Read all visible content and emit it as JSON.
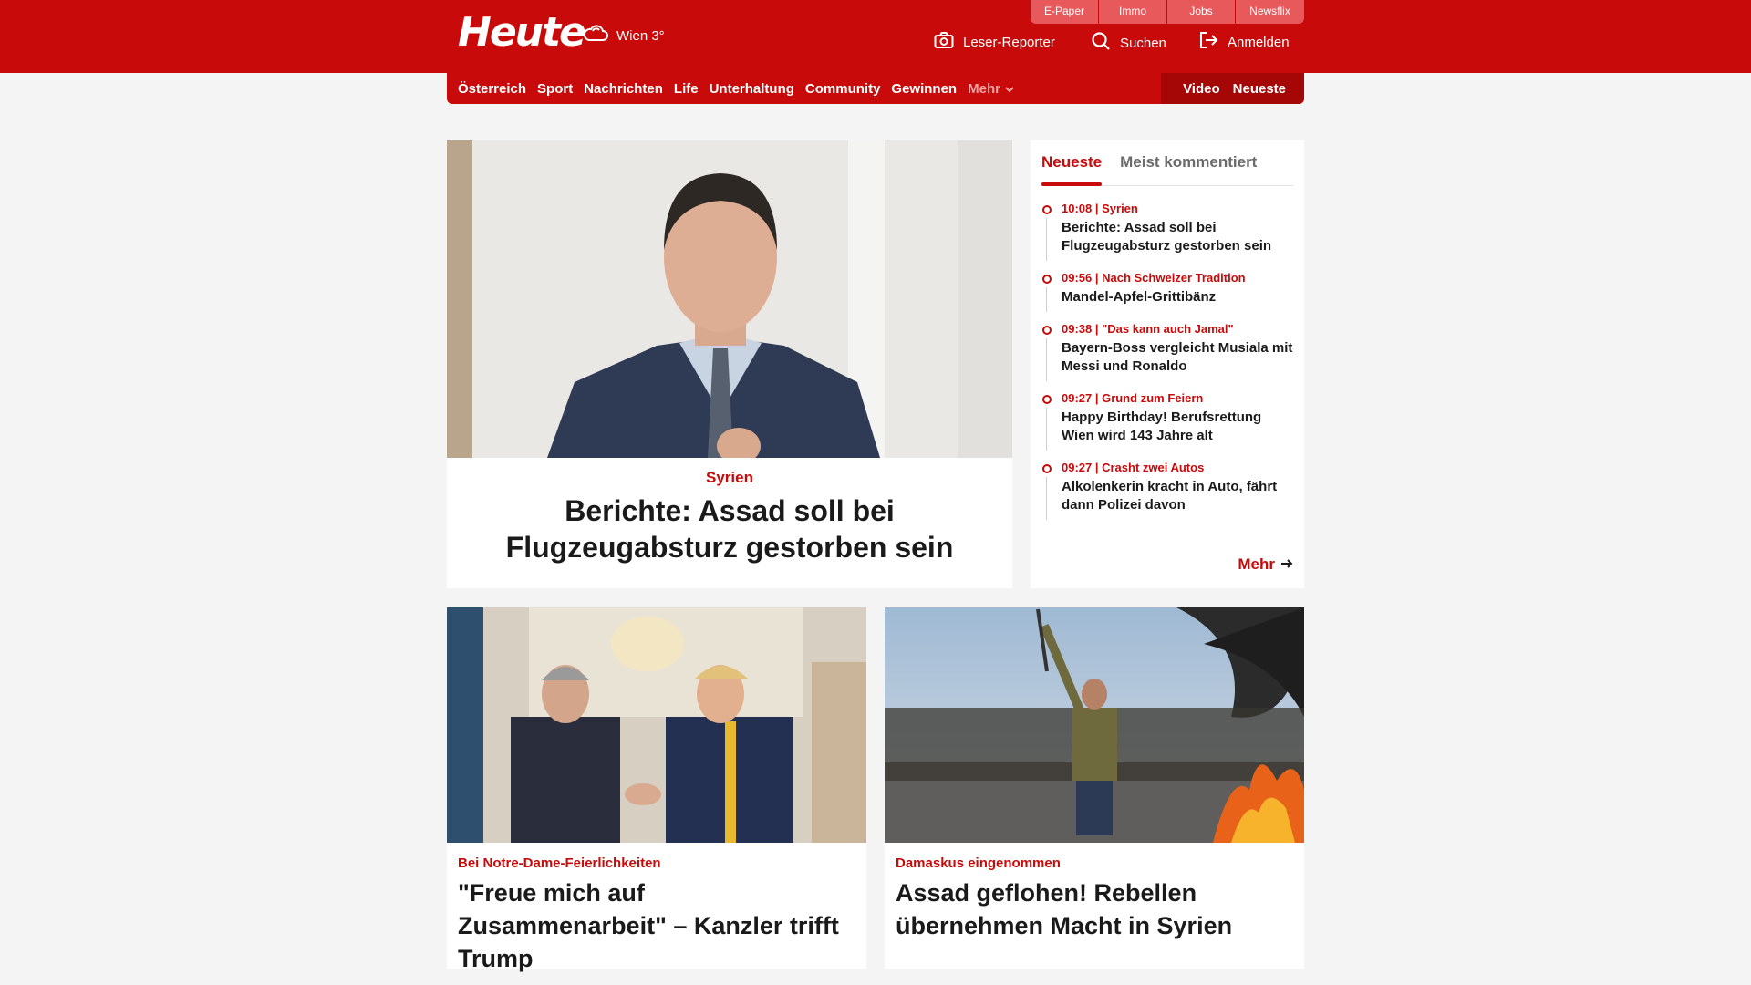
{
  "topbar": {
    "links": [
      "E-Paper",
      "Immo",
      "Jobs",
      "Newsflix"
    ]
  },
  "header": {
    "logo": "Heute",
    "weather": "Wien 3°",
    "actions": {
      "reporter": "Leser-Reporter",
      "search": "Suchen",
      "login": "Anmelden"
    }
  },
  "nav": {
    "items": [
      "Österreich",
      "Sport",
      "Nachrichten",
      "Life",
      "Unterhaltung",
      "Community",
      "Gewinnen"
    ],
    "more": "Mehr",
    "right": {
      "video": "Video",
      "newest": "Neueste"
    }
  },
  "hero": {
    "kicker": "Syrien",
    "title": "Berichte: Assad soll bei Flugzeugabsturz gestorben sein"
  },
  "sidebar": {
    "tabs": [
      "Neueste",
      "Meist kommentiert"
    ],
    "items": [
      {
        "meta": "10:08 | Syrien",
        "title": "Berichte: Assad soll bei Flugzeugabsturz gestorben sein"
      },
      {
        "meta": "09:56 | Nach Schweizer Tradition",
        "title": "Mandel-Apfel-Grittibänz"
      },
      {
        "meta": "09:38 | \"Das kann auch Jamal\"",
        "title": "Bayern-Boss vergleicht Musiala mit Messi und Ronaldo"
      },
      {
        "meta": "09:27 | Grund zum Feiern",
        "title": "Happy Birthday! Berufsrettung Wien wird 143 Jahre alt"
      },
      {
        "meta": "09:27 | Crasht zwei Autos",
        "title": "Alkolenkerin kracht in Auto, fährt dann Polizei davon"
      }
    ],
    "more": "Mehr"
  },
  "cards": [
    {
      "kicker": "Bei Notre-Dame-Feierlichkeiten",
      "title": "\"Freue mich auf Zusammenarbeit\" – Kanzler trifft Trump"
    },
    {
      "kicker": "Damaskus eingenommen",
      "title": "Assad geflohen! Rebellen übernehmen Macht in Syrien"
    }
  ],
  "colors": {
    "brand": "#c80a0a",
    "navDark": "#a50707",
    "topbarLink": "#e8595c"
  },
  "icons": [
    "weather-cloud-icon",
    "camera-icon",
    "search-icon",
    "login-icon",
    "chevron-down-icon",
    "arrow-right-icon"
  ]
}
